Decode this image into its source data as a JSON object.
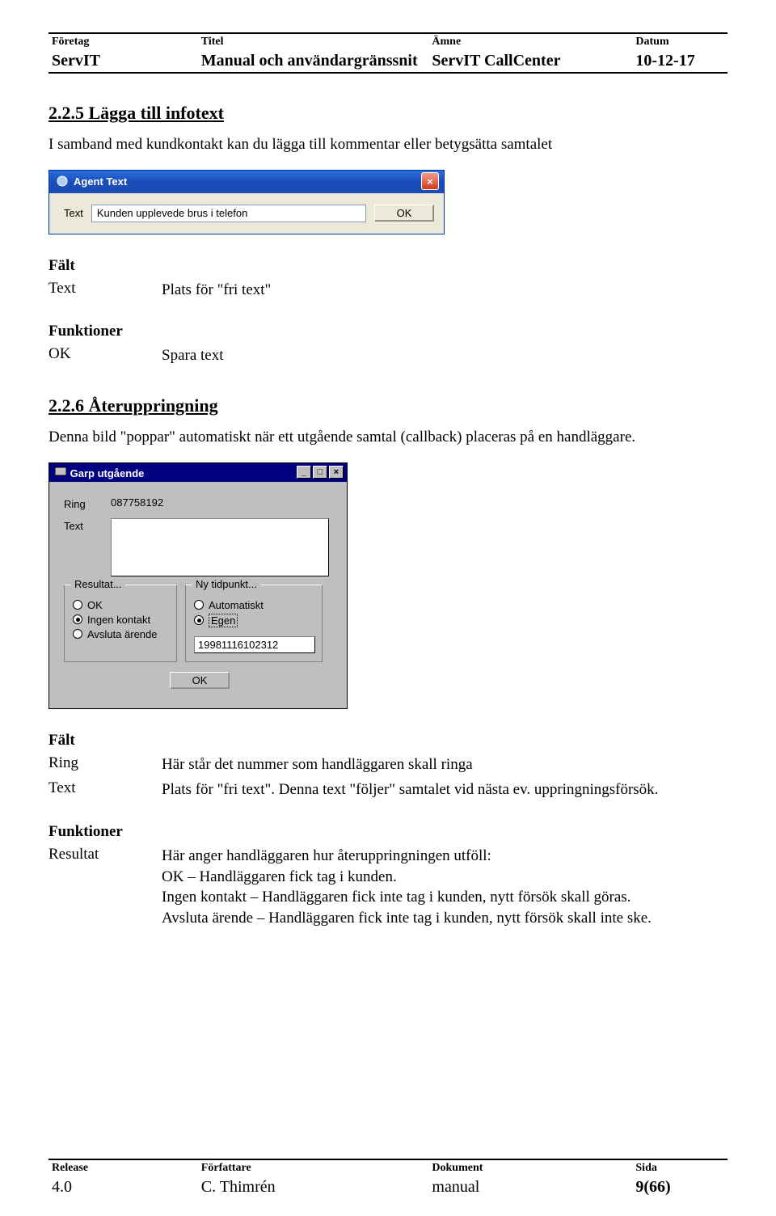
{
  "header": {
    "labels": {
      "company": "Företag",
      "title": "Titel",
      "subject": "Ämne",
      "date": "Datum"
    },
    "values": {
      "company": "ServIT",
      "title": "Manual och användargränssnit",
      "subject": "ServIT CallCenter",
      "date": "10-12-17"
    }
  },
  "section1": {
    "heading": "2.2.5 Lägga till infotext",
    "intro": "I samband med kundkontakt kan du lägga till kommentar eller betygsätta samtalet",
    "dialog": {
      "title": "Agent Text",
      "text_label": "Text",
      "text_value": "Kunden upplevede brus i telefon",
      "ok_label": "OK",
      "close_icon": "×"
    },
    "falt_heading": "Fält",
    "field_rows": [
      {
        "key": "Text",
        "val": "Plats för \"fri text\""
      }
    ],
    "funk_heading": "Funktioner",
    "funk_rows": [
      {
        "key": "OK",
        "val": "Spara text"
      }
    ]
  },
  "section2": {
    "heading": "2.2.6 Återuppringning",
    "intro": "Denna bild \"poppar\" automatiskt när ett utgående samtal (callback) placeras på en handläggare.",
    "dialog": {
      "title": "Garp utgående",
      "ring_label": "Ring",
      "ring_value": "087758192",
      "text_label": "Text",
      "group1_legend": "Resultat...",
      "group1_options": {
        "ok": "OK",
        "ingen": "Ingen kontakt",
        "avsluta": "Avsluta ärende"
      },
      "group2_legend": "Ny tidpunkt...",
      "group2_options": {
        "auto": "Automatiskt",
        "egen": "Egen"
      },
      "timestamp": "19981116102312",
      "ok_label": "OK",
      "ctrl_min": "_",
      "ctrl_max": "□",
      "ctrl_close": "×"
    },
    "falt_heading": "Fält",
    "field_rows": [
      {
        "key": "Ring",
        "val": "Här står det nummer som handläggaren skall ringa"
      },
      {
        "key": "Text",
        "val": "Plats för \"fri text\". Denna text \"följer\" samtalet vid nästa ev. uppringningsförsök."
      }
    ],
    "funk_heading": "Funktioner",
    "resultat_key": "Resultat",
    "resultat_lines": [
      "Här anger handläggaren hur återuppringningen utföll:",
      "OK – Handläggaren fick tag i kunden.",
      "Ingen kontakt – Handläggaren fick inte tag i kunden, nytt försök skall göras.",
      "Avsluta ärende – Handläggaren fick inte tag i kunden, nytt försök skall inte ske."
    ]
  },
  "footer": {
    "labels": {
      "release": "Release",
      "author": "Författare",
      "document": "Dokument",
      "page": "Sida"
    },
    "values": {
      "release": "4.0",
      "author": "C. Thimrén",
      "document": "manual",
      "page": "9(66)"
    }
  }
}
